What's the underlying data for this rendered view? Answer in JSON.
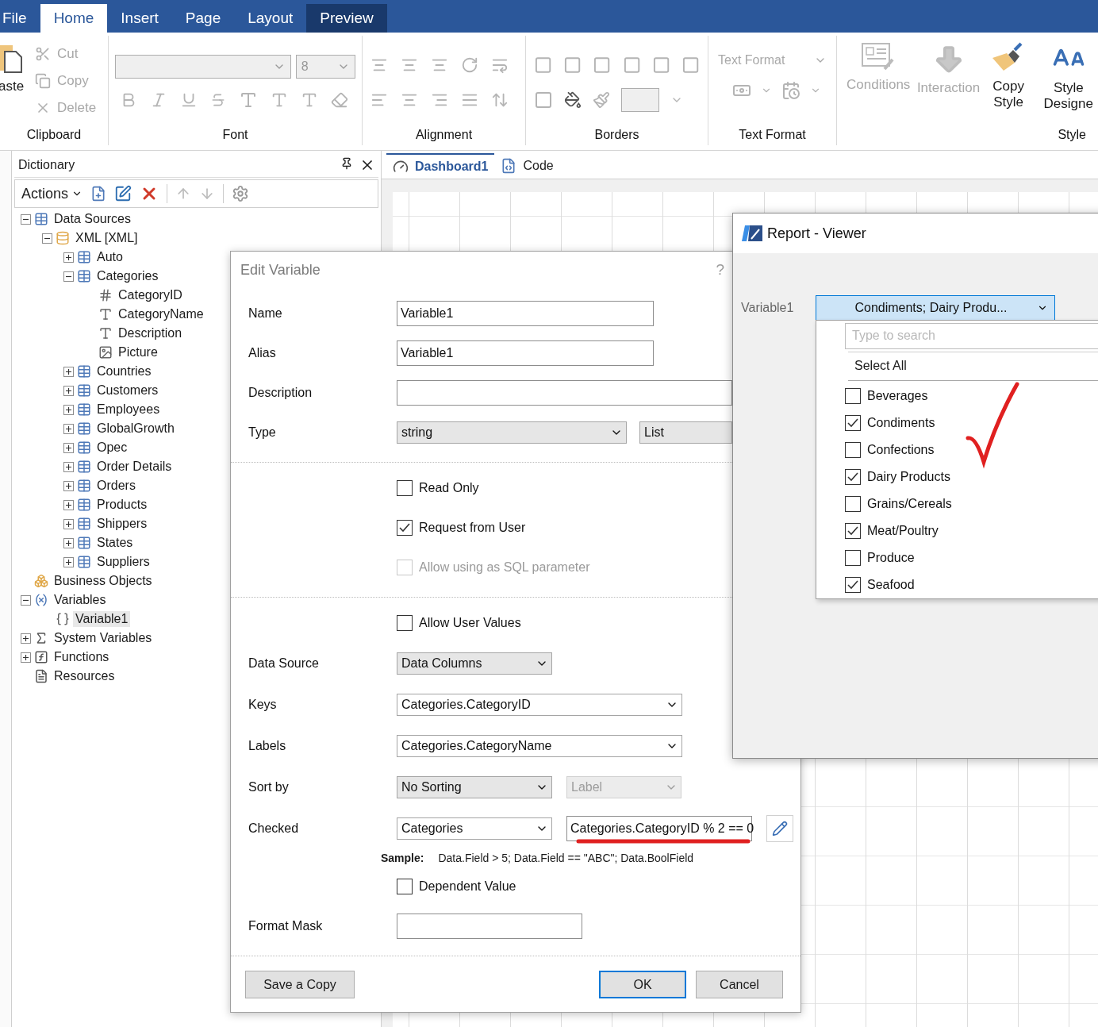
{
  "ribbon": {
    "tabs": [
      {
        "label": "File",
        "selected": false,
        "highlighted": false
      },
      {
        "label": "Home",
        "selected": true,
        "highlighted": false
      },
      {
        "label": "Insert",
        "selected": false,
        "highlighted": false
      },
      {
        "label": "Page",
        "selected": false,
        "highlighted": false
      },
      {
        "label": "Layout",
        "selected": false,
        "highlighted": false
      },
      {
        "label": "Preview",
        "selected": false,
        "highlighted": true
      }
    ],
    "clipboard": {
      "group": "Clipboard",
      "paste": "aste",
      "items": [
        {
          "label": "Cut",
          "kind": "cut",
          "disabled": true
        },
        {
          "label": "Copy",
          "kind": "copy",
          "disabled": true
        },
        {
          "label": "Delete",
          "kind": "delete",
          "disabled": true
        }
      ]
    },
    "font": {
      "group": "Font",
      "size": "8"
    },
    "alignment": {
      "group": "Alignment"
    },
    "borders": {
      "group": "Borders"
    },
    "text_format": {
      "group": "Text Format",
      "combo": "Text Format"
    },
    "style": {
      "group": "Style",
      "buttons": [
        {
          "label": "Conditions",
          "kind": "conditions",
          "disabled": true
        },
        {
          "label": "Interaction",
          "kind": "interaction",
          "disabled": true
        },
        {
          "label": "Copy Style",
          "kind": "copy-style",
          "disabled": false
        },
        {
          "label": "Style Designe",
          "kind": "style-designer",
          "disabled": false
        }
      ]
    }
  },
  "dictionary": {
    "title": "Dictionary",
    "actions": "Actions",
    "tree": [
      {
        "label": "Data Sources",
        "kind": "table",
        "expanded": true,
        "selected": false,
        "children": [
          {
            "label": "XML [XML]",
            "kind": "database",
            "expanded": true,
            "selected": false,
            "children": [
              {
                "label": "Auto",
                "kind": "table",
                "expanded": false,
                "selected": false
              },
              {
                "label": "Categories",
                "kind": "table",
                "expanded": true,
                "selected": false,
                "children": [
                  {
                    "label": "CategoryID",
                    "kind": "number",
                    "selected": false
                  },
                  {
                    "label": "CategoryName",
                    "kind": "text",
                    "selected": false
                  },
                  {
                    "label": "Description",
                    "kind": "text",
                    "selected": false
                  },
                  {
                    "label": "Picture",
                    "kind": "image",
                    "selected": false
                  }
                ]
              },
              {
                "label": "Countries",
                "kind": "table",
                "expanded": false,
                "selected": false
              },
              {
                "label": "Customers",
                "kind": "table",
                "expanded": false,
                "selected": false
              },
              {
                "label": "Employees",
                "kind": "table",
                "expanded": false,
                "selected": false
              },
              {
                "label": "GlobalGrowth",
                "kind": "table",
                "expanded": false,
                "selected": false
              },
              {
                "label": "Opec",
                "kind": "table",
                "expanded": false,
                "selected": false
              },
              {
                "label": "Order Details",
                "kind": "table",
                "expanded": false,
                "selected": false
              },
              {
                "label": "Orders",
                "kind": "table",
                "expanded": false,
                "selected": false
              },
              {
                "label": "Products",
                "kind": "table",
                "expanded": false,
                "selected": false
              },
              {
                "label": "Shippers",
                "kind": "table",
                "expanded": false,
                "selected": false
              },
              {
                "label": "States",
                "kind": "table",
                "expanded": false,
                "selected": false
              },
              {
                "label": "Suppliers",
                "kind": "table",
                "expanded": false,
                "selected": false
              }
            ]
          }
        ]
      },
      {
        "label": "Business Objects",
        "kind": "business",
        "selected": false
      },
      {
        "label": "Variables",
        "kind": "variables",
        "expanded": true,
        "selected": false,
        "children": [
          {
            "label": "Variable1",
            "kind": "variable",
            "selected": true
          }
        ]
      },
      {
        "label": "System Variables",
        "kind": "system",
        "expanded": false,
        "selected": false
      },
      {
        "label": "Functions",
        "kind": "functions",
        "expanded": false,
        "selected": false
      },
      {
        "label": "Resources",
        "kind": "resources",
        "selected": false
      }
    ]
  },
  "document_tabs": [
    {
      "label": "Dashboard1",
      "kind": "dashboard",
      "selected": true
    },
    {
      "label": "Code",
      "kind": "code",
      "selected": false
    }
  ],
  "edit_variable": {
    "title": "Edit Variable",
    "help": "?",
    "rows": [
      {
        "kind": "text",
        "label": "Name",
        "value": "Variable1"
      },
      {
        "kind": "text",
        "label": "Alias",
        "value": "Variable1"
      },
      {
        "kind": "wide-text",
        "label": "Description"
      },
      {
        "kind": "type",
        "label": "Type",
        "value": "string",
        "secondary": "List"
      },
      {
        "kind": "separator"
      },
      {
        "kind": "checkbox",
        "label": "Read Only",
        "checked": false,
        "disabled": false
      },
      {
        "kind": "checkbox",
        "label": "Request from User",
        "checked": true,
        "disabled": false
      },
      {
        "kind": "checkbox",
        "label": "Allow using as SQL parameter",
        "checked": false,
        "disabled": true
      },
      {
        "kind": "separator"
      },
      {
        "kind": "checkbox",
        "label": "Allow User Values",
        "checked": false,
        "disabled": false
      },
      {
        "kind": "select",
        "label": "Data Source",
        "value": "Data Columns"
      },
      {
        "kind": "wide-select",
        "label": "Keys",
        "value": "Categories.CategoryID"
      },
      {
        "kind": "wide-select",
        "label": "Labels",
        "value": "Categories.CategoryName"
      },
      {
        "kind": "sort",
        "label": "Sort by",
        "value": "No Sorting",
        "secondary": "Label",
        "secondary_disabled": true
      },
      {
        "kind": "expression",
        "label": "Checked",
        "value": "Categories",
        "expression": "Categories.CategoryID % 2 == 0"
      },
      {
        "kind": "sample",
        "label": "Sample:",
        "text": "Data.Field > 5; Data.Field == \"ABC\"; Data.BoolField"
      },
      {
        "kind": "checkbox",
        "label": "Dependent Value",
        "checked": false,
        "disabled": false
      },
      {
        "kind": "short-text",
        "label": "Format Mask"
      },
      {
        "kind": "separator"
      }
    ],
    "buttons": [
      {
        "label": "Save a Copy",
        "kind": "left"
      },
      {
        "label": "OK",
        "kind": "default"
      },
      {
        "label": "Cancel",
        "kind": "right"
      }
    ]
  },
  "viewer": {
    "title": "Report - Viewer",
    "variable_label": "Variable1",
    "dropdown_value": "Condiments; Dairy Produ...",
    "search_placeholder": "Type to search",
    "select_all": "Select All",
    "items": [
      {
        "label": "Beverages",
        "checked": false
      },
      {
        "label": "Condiments",
        "checked": true
      },
      {
        "label": "Confections",
        "checked": false
      },
      {
        "label": "Dairy Products",
        "checked": true
      },
      {
        "label": "Grains/Cereals",
        "checked": false
      },
      {
        "label": "Meat/Poultry",
        "checked": true
      },
      {
        "label": "Produce",
        "checked": false
      },
      {
        "label": "Seafood",
        "checked": true
      }
    ]
  }
}
